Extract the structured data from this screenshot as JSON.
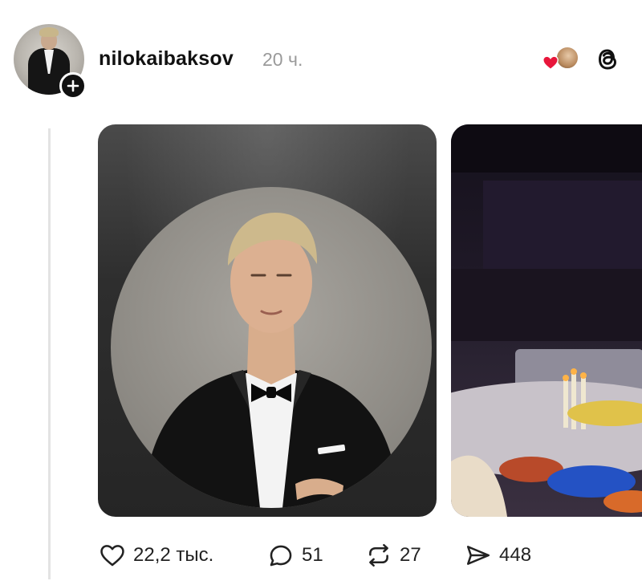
{
  "post": {
    "username": "nilokaibaksov",
    "time": "20 ч."
  },
  "header_icons": {
    "liked_by": "heart-with-avatar-icon",
    "app": "threads-icon"
  },
  "media": [
    {
      "name": "portrait-photo"
    },
    {
      "name": "banquet-photo"
    }
  ],
  "actions": {
    "like_count": "22,2 тыс.",
    "comment_count": "51",
    "repost_count": "27",
    "share_count": "448"
  },
  "colors": {
    "like_heart": "#e8163b",
    "muted_text": "#9a9a9a",
    "thread_line": "#e3e3e3"
  }
}
